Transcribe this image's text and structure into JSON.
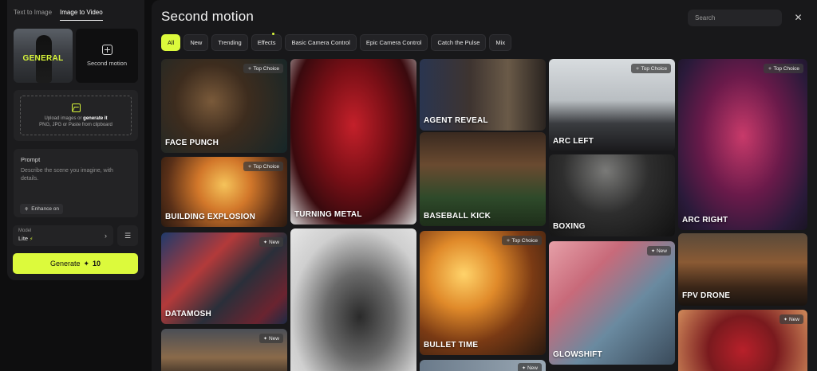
{
  "left_panel": {
    "tabs": [
      {
        "label": "Text to Image",
        "active": false
      },
      {
        "label": "Image to Video",
        "active": true
      }
    ],
    "thumb_general_label": "GENERAL",
    "second_motion_label": "Second motion",
    "upload": {
      "line1_prefix": "Upload images or",
      "line1_link": "generate it",
      "line2": "PNG, JPG or Paste from clipboard"
    },
    "prompt": {
      "label": "Prompt",
      "placeholder": "Describe the scene you imagine, with details."
    },
    "enhance_label": "Enhance on",
    "model": {
      "label": "Model",
      "value": "Lite"
    },
    "generate": {
      "label": "Generate",
      "count": "10"
    }
  },
  "main": {
    "title": "Second motion",
    "search_placeholder": "Search",
    "chips": [
      {
        "label": "All",
        "active": true
      },
      {
        "label": "New",
        "active": false
      },
      {
        "label": "Trending",
        "active": false
      },
      {
        "label": "Effects",
        "active": false,
        "dot": true
      },
      {
        "label": "Basic Camera Control",
        "active": false
      },
      {
        "label": "Epic Camera Control",
        "active": false
      },
      {
        "label": "Catch the Pulse",
        "active": false
      },
      {
        "label": "Mix",
        "active": false
      }
    ],
    "cards": [
      {
        "label": "FACE PUNCH",
        "badge": "Top Choice"
      },
      {
        "label": "BUILDING EXPLOSION",
        "badge": "Top Choice"
      },
      {
        "label": "DATAMOSH",
        "badge": "New"
      },
      {
        "label": "",
        "badge": "New"
      },
      {
        "label": "TURNING METAL",
        "badge": ""
      },
      {
        "label": "",
        "badge": ""
      },
      {
        "label": "AGENT REVEAL",
        "badge": ""
      },
      {
        "label": "BASEBALL KICK",
        "badge": ""
      },
      {
        "label": "BULLET TIME",
        "badge": "Top Choice"
      },
      {
        "label": "",
        "badge": "New"
      },
      {
        "label": "ARC LEFT",
        "badge": "Top Choice"
      },
      {
        "label": "BOXING",
        "badge": ""
      },
      {
        "label": "GLOWSHIFT",
        "badge": "New"
      },
      {
        "label": "ARC RIGHT",
        "badge": "Top Choice"
      },
      {
        "label": "FPV DRONE",
        "badge": ""
      },
      {
        "label": "",
        "badge": "New"
      }
    ]
  },
  "colors": {
    "accent": "#dcfa3c",
    "panel": "#1b1b1d",
    "main_bg": "#18181a"
  }
}
